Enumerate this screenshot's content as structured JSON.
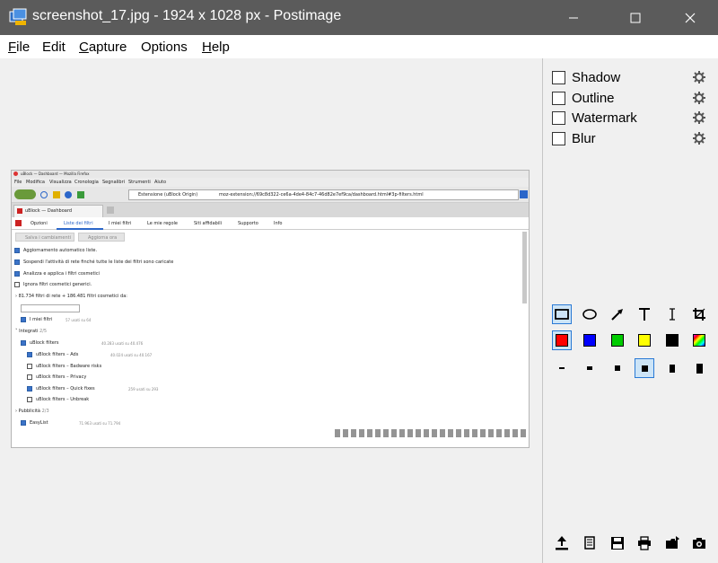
{
  "window": {
    "title": "screenshot_17.jpg - 1924 x 1028 px - Postimage",
    "controls": [
      "minimize",
      "maximize",
      "close"
    ]
  },
  "menu": [
    {
      "label": "File",
      "mnemonic": "F",
      "rest": "ile"
    },
    {
      "label": "Edit",
      "mnemonic": "",
      "rest": "Edit"
    },
    {
      "label": "Capture",
      "mnemonic": "C",
      "rest": "apture"
    },
    {
      "label": "Options",
      "mnemonic": "",
      "rest": "Options"
    },
    {
      "label": "Help",
      "mnemonic": "H",
      "rest": "elp"
    }
  ],
  "effects": [
    {
      "label": "Shadow",
      "checked": false
    },
    {
      "label": "Outline",
      "checked": false
    },
    {
      "label": "Watermark",
      "checked": false
    },
    {
      "label": "Blur",
      "checked": false
    }
  ],
  "tools": [
    "rectangle-icon",
    "ellipse-icon",
    "arrow-icon",
    "text-icon",
    "text-cursor-icon",
    "crop-icon"
  ],
  "colors": [
    "#ff0000",
    "#0000ff",
    "#00cc00",
    "#ffff00",
    "#000000",
    "rainbow"
  ],
  "sizes": [
    "1",
    "2",
    "3",
    "4",
    "5",
    "6"
  ],
  "actions": [
    "upload-icon",
    "copy-icon",
    "save-icon",
    "print-icon",
    "open-folder-icon",
    "camera-icon"
  ],
  "inner_screenshot": {
    "window_title": "uBlock — Dashboard — Mozilla Firefox",
    "menus": [
      "File",
      "Modifica",
      "Visualizza",
      "Cronologia",
      "Segnalibri",
      "Strumenti",
      "Aiuto"
    ],
    "address_label": "Estensione (uBlock Origin)",
    "url": "moz-extension://69c8d322-ce6a-4de4-84c7-46d82e7ef9ca/dashboard.html#3p-filters.html",
    "tab": "uBlock — Dashboard",
    "nav_tabs": [
      "Opzioni",
      "Liste dei filtri",
      "I miei filtri",
      "Le mie regole",
      "Siti affidabili",
      "Supporto",
      "Info"
    ],
    "buttons": [
      "Salva i cambiamenti",
      "Aggiorna ora"
    ],
    "lines": [
      {
        "text": "Aggiornamento automatico liste.",
        "checked": true,
        "indent": 0
      },
      {
        "text": "Sospendi l'attività di rete finché tutte le liste dei filtri sono caricate",
        "checked": true,
        "indent": 0
      },
      {
        "text": "Analizza e applica i filtri cosmetici",
        "checked": true,
        "indent": 0
      },
      {
        "text": "Ignora filtri cosmetici generici.",
        "checked": false,
        "indent": 0
      }
    ],
    "summary": "81.734 filtri di rete + 186.481 filtri cosmetici da:",
    "my_filters": "I miei filtri",
    "my_filters_count": "57 usati su 64",
    "group_builtin": "Integrati",
    "group_builtin_count": "2/5",
    "ublock_filters": "uBlock filters",
    "ublock_filters_count": "40.283 usati su 40.476",
    "sub_lists": [
      {
        "text": "uBlock filters – Ads",
        "checked": true,
        "count": "40.024 usati su 40.167"
      },
      {
        "text": "uBlock filters – Badware risks",
        "checked": false,
        "count": ""
      },
      {
        "text": "uBlock filters – Privacy",
        "checked": false,
        "count": ""
      },
      {
        "text": "uBlock filters – Quick fixes",
        "checked": true,
        "count": "259 usati su 293"
      },
      {
        "text": "uBlock filters – Unbreak",
        "checked": false,
        "count": ""
      }
    ],
    "group_ads": "Pubblicità",
    "group_ads_count": "2/3",
    "easylist": "EasyList",
    "easylist_count": "71.963 usati su 71.794"
  }
}
